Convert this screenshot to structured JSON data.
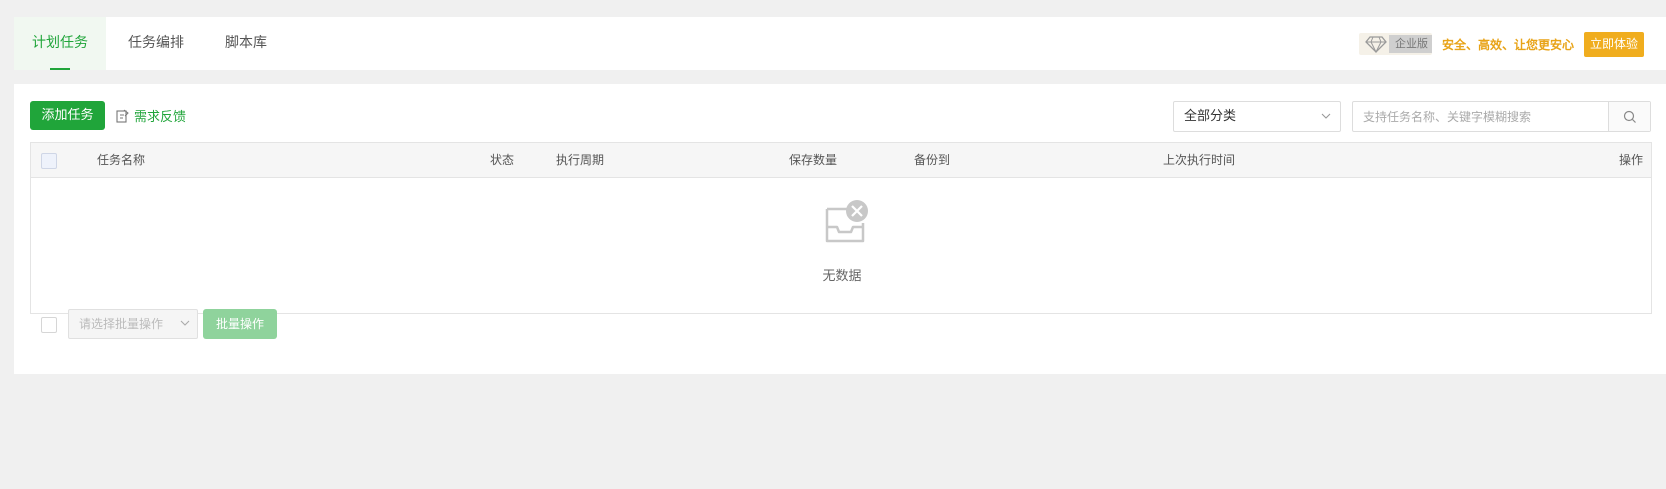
{
  "tabs": [
    {
      "label": "计划任务",
      "active": true
    },
    {
      "label": "任务编排",
      "active": false
    },
    {
      "label": "脚本库",
      "active": false
    }
  ],
  "promo": {
    "badge": "企业版",
    "slogan": "安全、高效、让您更安心",
    "button": "立即体验",
    "icon": "diamond-icon"
  },
  "toolbar": {
    "add_label": "添加任务",
    "feedback_label": "需求反馈",
    "category_value": "全部分类",
    "search_placeholder": "支持任务名称、关键字模糊搜索"
  },
  "table": {
    "columns": [
      "任务名称",
      "状态",
      "执行周期",
      "保存数量",
      "备份到",
      "上次执行时间",
      "操作"
    ],
    "rows": [],
    "empty_text": "无数据"
  },
  "footer": {
    "batch_placeholder": "请选择批量操作",
    "batch_button": "批量操作"
  },
  "colors": {
    "primary": "#20a53a",
    "promo": "#f0ad1e"
  }
}
